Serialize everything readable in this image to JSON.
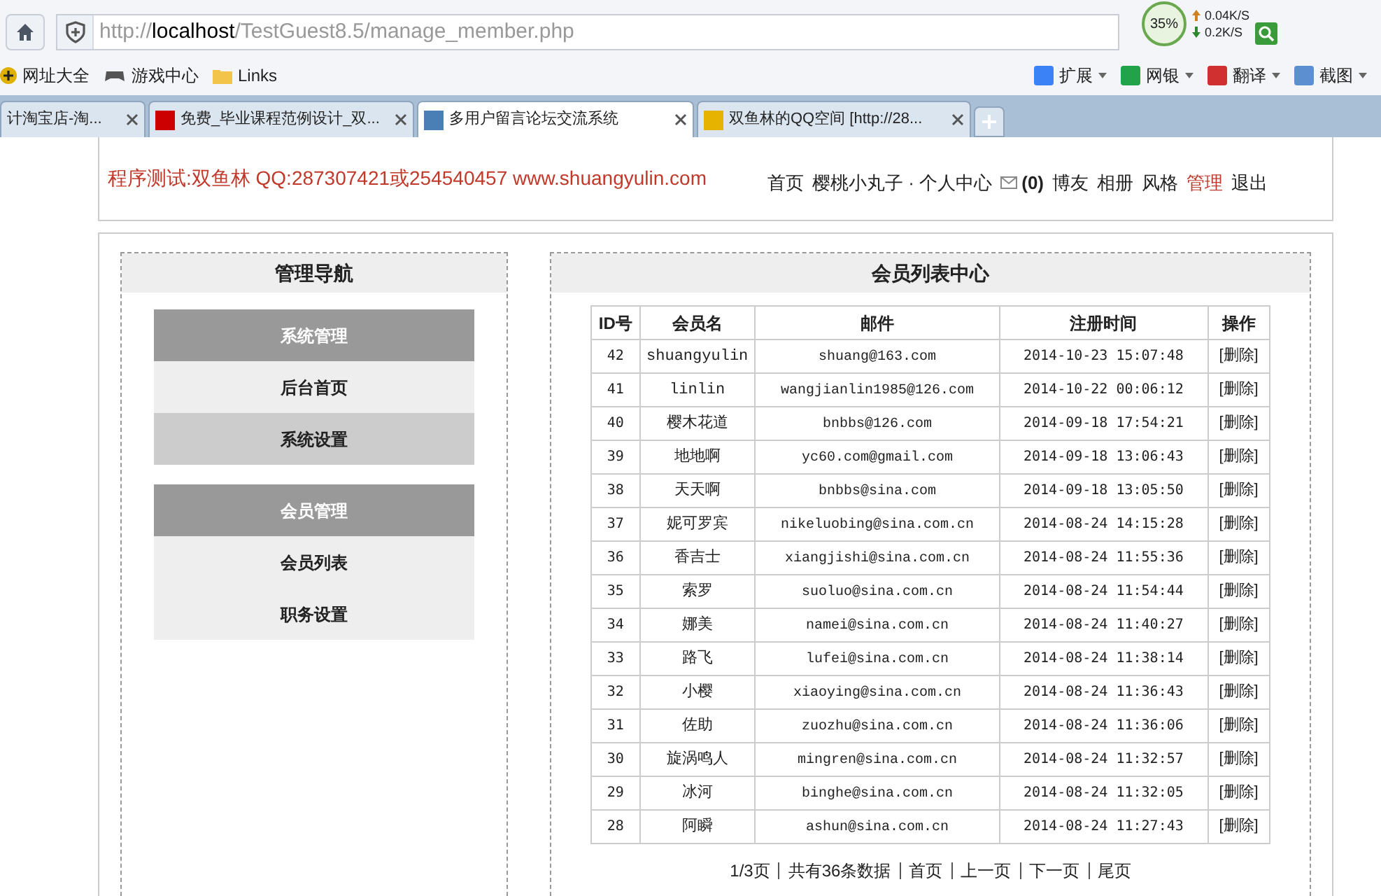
{
  "browser": {
    "address": {
      "scheme": "http://",
      "host": "localhost",
      "path": "/TestGuest8.5/manage_member.php"
    },
    "speed": {
      "percent": "35%",
      "up": "0.04K/S",
      "down": "0.2K/S"
    },
    "bookmarks": [
      "网址大全",
      "游戏中心",
      "Links"
    ],
    "tools": [
      "扩展",
      "网银",
      "翻译",
      "截图"
    ],
    "tabs": [
      {
        "title": "计淘宝店-淘...",
        "selected": false
      },
      {
        "title": "免费_毕业课程范例设计_双...",
        "selected": false
      },
      {
        "title": "多用户留言论坛交流系统",
        "selected": true
      },
      {
        "title": "双鱼林的QQ空间 [http://28...",
        "selected": false
      }
    ]
  },
  "header": {
    "credit": "程序测试:双鱼林 QQ:287307421或254540457 www.shuangyulin.com",
    "nav": [
      {
        "label": "首页",
        "selected": false
      },
      {
        "label": "樱桃小丸子 · 个人中心",
        "selected": false
      },
      {
        "label": "(0)",
        "selected": false,
        "kind": "mail"
      },
      {
        "label": "博友",
        "selected": false
      },
      {
        "label": "相册",
        "selected": false
      },
      {
        "label": "风格",
        "selected": false
      },
      {
        "label": "管理",
        "selected": true
      },
      {
        "label": "退出",
        "selected": false
      }
    ]
  },
  "sidebar": {
    "title": "管理导航",
    "groups": [
      {
        "title": "系统管理",
        "items": [
          {
            "label": "后台首页",
            "selected": false
          },
          {
            "label": "系统设置",
            "selected": true
          }
        ]
      },
      {
        "title": "会员管理",
        "items": [
          {
            "label": "会员列表",
            "selected": false
          },
          {
            "label": "职务设置",
            "selected": false
          }
        ]
      }
    ]
  },
  "main": {
    "title": "会员列表中心",
    "columns": [
      "ID号",
      "会员名",
      "邮件",
      "注册时间",
      "操作"
    ],
    "rows": [
      [
        "42",
        "shuangyulin",
        "shuang@163.com",
        "2014-10-23 15:07:48",
        "[删除]"
      ],
      [
        "41",
        "linlin",
        "wangjianlin1985@126.com",
        "2014-10-22 00:06:12",
        "[删除]"
      ],
      [
        "40",
        "樱木花道",
        "bnbbs@126.com",
        "2014-09-18 17:54:21",
        "[删除]"
      ],
      [
        "39",
        "地地啊",
        "yc60.com@gmail.com",
        "2014-09-18 13:06:43",
        "[删除]"
      ],
      [
        "38",
        "天天啊",
        "bnbbs@sina.com",
        "2014-09-18 13:05:50",
        "[删除]"
      ],
      [
        "37",
        "妮可罗宾",
        "nikeluobing@sina.com.cn",
        "2014-08-24 14:15:28",
        "[删除]"
      ],
      [
        "36",
        "香吉士",
        "xiangjishi@sina.com.cn",
        "2014-08-24 11:55:36",
        "[删除]"
      ],
      [
        "35",
        "索罗",
        "suoluo@sina.com.cn",
        "2014-08-24 11:54:44",
        "[删除]"
      ],
      [
        "34",
        "娜美",
        "namei@sina.com.cn",
        "2014-08-24 11:40:27",
        "[删除]"
      ],
      [
        "33",
        "路飞",
        "lufei@sina.com.cn",
        "2014-08-24 11:38:14",
        "[删除]"
      ],
      [
        "32",
        "小樱",
        "xiaoying@sina.com.cn",
        "2014-08-24 11:36:43",
        "[删除]"
      ],
      [
        "31",
        "佐助",
        "zuozhu@sina.com.cn",
        "2014-08-24 11:36:06",
        "[删除]"
      ],
      [
        "30",
        "旋涡鸣人",
        "mingren@sina.com.cn",
        "2014-08-24 11:32:57",
        "[删除]"
      ],
      [
        "29",
        "冰河",
        "binghe@sina.com.cn",
        "2014-08-24 11:32:05",
        "[删除]"
      ],
      [
        "28",
        "阿瞬",
        "ashun@sina.com.cn",
        "2014-08-24 11:27:43",
        "[删除]"
      ]
    ],
    "pagination": [
      "1/3页",
      "共有36条数据",
      "首页",
      "上一页",
      "下一页",
      "尾页"
    ]
  }
}
